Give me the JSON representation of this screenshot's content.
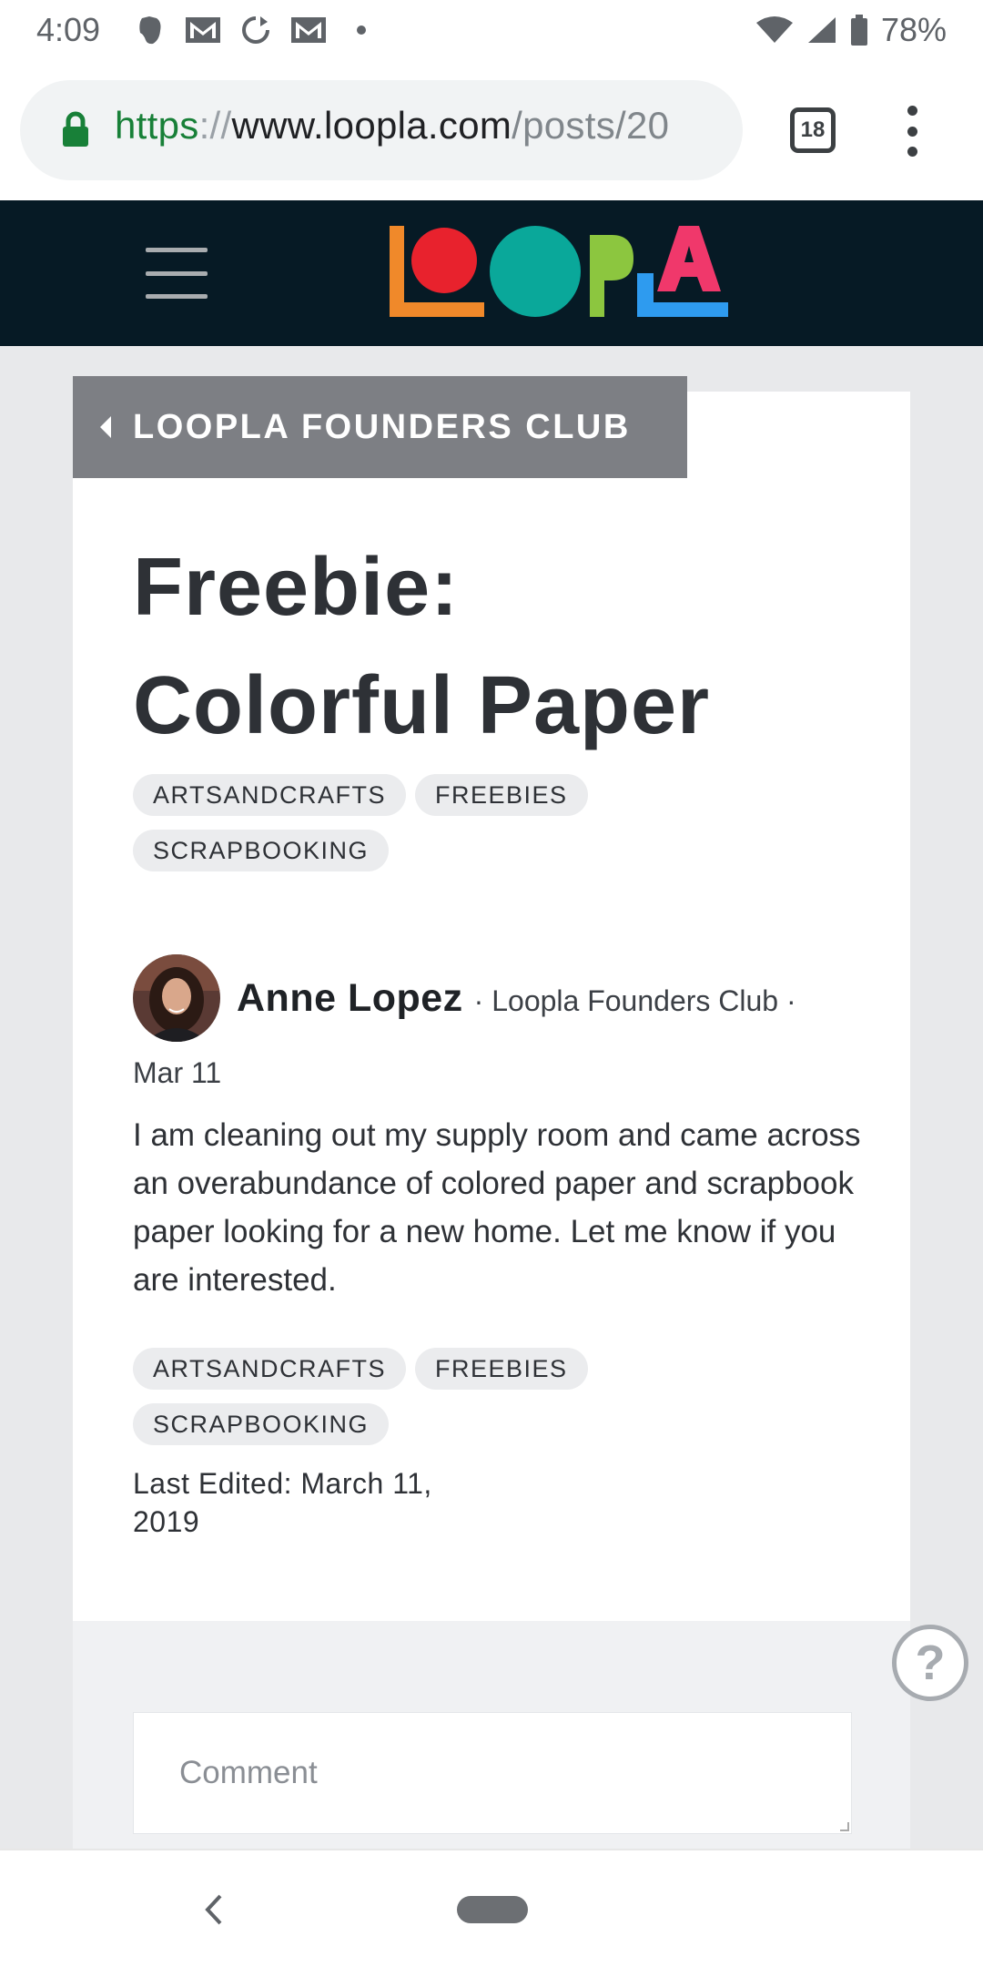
{
  "status_bar": {
    "time": "4:09",
    "battery": "78%",
    "icons": [
      "evernote-icon",
      "gmail-icon",
      "sync-icon",
      "gmail-icon",
      "dot-icon",
      "wifi-icon",
      "signal-icon",
      "battery-icon"
    ]
  },
  "browser": {
    "url_scheme": "https",
    "url_sep": "://",
    "url_host": "www.loopla.com",
    "url_path": "/posts/20",
    "tab_count": "18"
  },
  "site": {
    "brand": "LOOPLA",
    "colors": {
      "header_bg": "#061a25",
      "l1": "#f0892a",
      "o1": "#e8222d",
      "o2": "#0aa89a",
      "p": "#8cc63f",
      "l2": "#2e9bef",
      "a": "#f0386b"
    }
  },
  "post": {
    "group_label": "LOOPLA FOUNDERS CLUB",
    "title_line1": "Freebie:",
    "title_line2": "Colorful Paper",
    "tags_top": [
      "ARTSANDCRAFTS",
      "FREEBIES",
      "SCRAPBOOKING"
    ],
    "author": "Anne Lopez",
    "meta": "· Loopla Founders Club ·",
    "date": "Mar 11",
    "body": "I am cleaning out my supply room and came across an overabundance of colored paper and scrapbook paper looking for a new home. Let me know if you are interested.",
    "tags_bottom": [
      "ARTSANDCRAFTS",
      "FREEBIES",
      "SCRAPBOOKING"
    ],
    "edited_line1": "Last Edited: March 11,",
    "edited_line2": "2019"
  },
  "comment": {
    "placeholder": "Comment"
  },
  "help": {
    "glyph": "?"
  }
}
